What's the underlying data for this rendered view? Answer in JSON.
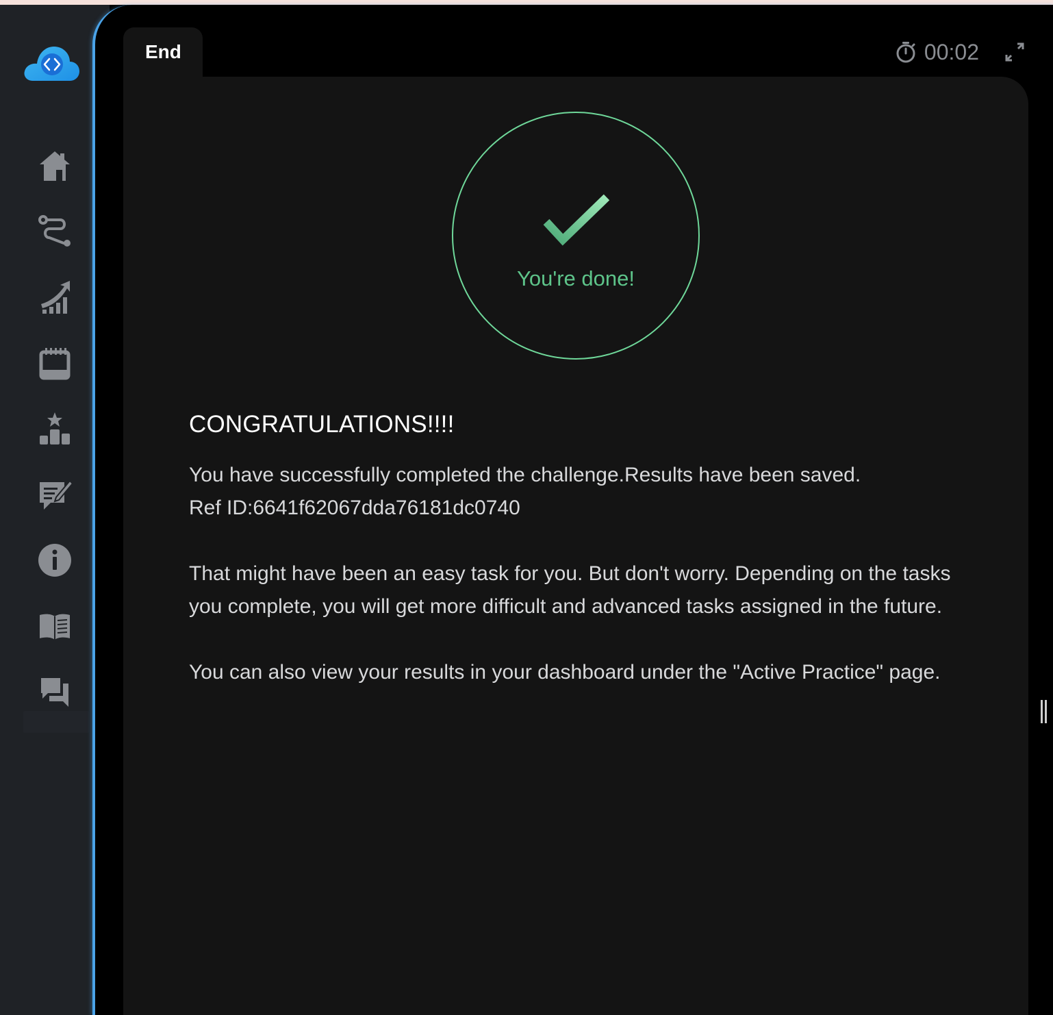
{
  "app": {
    "logo_icon": "cloud-code-icon"
  },
  "sidebar": {
    "items": [
      {
        "name": "home",
        "icon": "home-icon"
      },
      {
        "name": "path",
        "icon": "route-icon"
      },
      {
        "name": "progress",
        "icon": "growth-chart-icon"
      },
      {
        "name": "calendar",
        "icon": "calendar-icon"
      },
      {
        "name": "leaderboard",
        "icon": "podium-star-icon"
      },
      {
        "name": "feedback",
        "icon": "edit-message-icon"
      },
      {
        "name": "info",
        "icon": "info-icon"
      },
      {
        "name": "docs",
        "icon": "book-icon"
      },
      {
        "name": "forum",
        "icon": "chat-icon"
      }
    ]
  },
  "header": {
    "tab_label": "End",
    "timer": "00:02",
    "timer_icon": "stopwatch-icon",
    "expand_icon": "expand-icon"
  },
  "result": {
    "status_text": "You're done!",
    "title": "CONGRATULATIONS!!!!",
    "line1": "You have successfully completed the challenge.Results have been saved.",
    "line2": "Ref ID:6641f62067dda76181dc0740",
    "para2": "That might have been an easy task for you. But don't worry. Depending on the tasks you complete, you will get more difficult and advanced tasks assigned in the future.",
    "para3": "You can also view your results in your dashboard under the \"Active Practice\" page."
  },
  "colors": {
    "accent_blue": "#4aa3e8",
    "success_green": "#5ec48a",
    "panel_bg": "#141414",
    "sidebar_bg": "#1f2226"
  }
}
